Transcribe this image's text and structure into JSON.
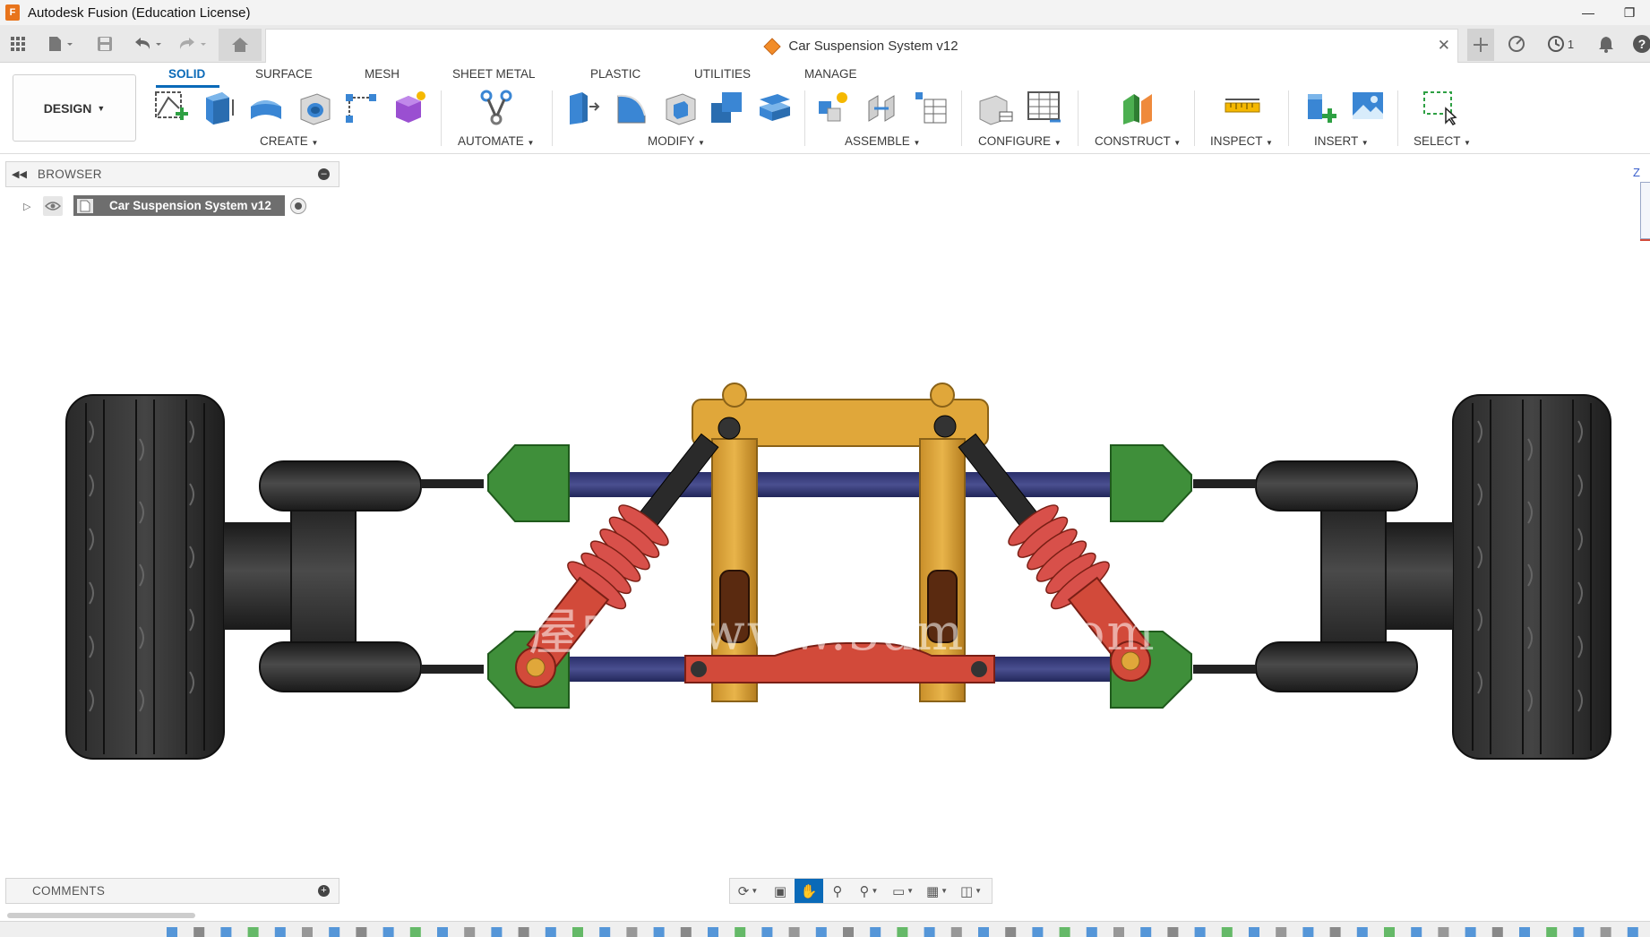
{
  "app": {
    "title": "Autodesk Fusion (Education License)",
    "icon_letter": "F",
    "brand_color": "#e8741c",
    "accent_color": "#0a6ab8"
  },
  "window_controls": [
    "minimize-icon",
    "restore-icon"
  ],
  "tabbar": {
    "document_tab_label": "Car Suspension System v12",
    "left_icons": [
      "grid-icon",
      "file-icon",
      "save-icon",
      "undo-icon",
      "redo-icon",
      "home-icon"
    ],
    "right_icons": [
      "plus-icon",
      "online-status-icon",
      "job-status-icon",
      "notifications-icon",
      "help-icon"
    ],
    "job_count": "1"
  },
  "ribbon": {
    "workspace_button": "DESIGN",
    "tabs": [
      "SOLID",
      "SURFACE",
      "MESH",
      "SHEET METAL",
      "PLASTIC",
      "UTILITIES",
      "MANAGE"
    ],
    "active_tab": "SOLID",
    "groups": [
      {
        "label": "CREATE",
        "tools": [
          "create-sketch-icon",
          "extrude-icon",
          "revolve-icon",
          "hole-icon",
          "pattern-icon",
          "form-icon"
        ]
      },
      {
        "label": "AUTOMATE",
        "tools": [
          "automate-icon"
        ]
      },
      {
        "label": "MODIFY",
        "tools": [
          "press-pull-icon",
          "fillet-icon",
          "shell-icon",
          "combine-icon",
          "offset-face-icon"
        ]
      },
      {
        "label": "ASSEMBLE",
        "tools": [
          "new-component-icon",
          "joint-icon",
          "bom-icon"
        ]
      },
      {
        "label": "CONFIGURE",
        "tools": [
          "configure-icon",
          "config-table-icon"
        ]
      },
      {
        "label": "CONSTRUCT",
        "tools": [
          "construct-plane-icon"
        ]
      },
      {
        "label": "INSPECT",
        "tools": [
          "measure-icon"
        ]
      },
      {
        "label": "INSERT",
        "tools": [
          "insert-icon",
          "insert-image-icon"
        ]
      },
      {
        "label": "SELECT",
        "tools": [
          "window-select-icon"
        ]
      }
    ]
  },
  "browser": {
    "header": "BROWSER",
    "root_node": "Car Suspension System v12"
  },
  "viewport": {
    "watermark": "屋内闪 www.3dmox.com",
    "viewcube_axis": "Z"
  },
  "comments": {
    "header": "COMMENTS"
  },
  "navbar": {
    "tools": [
      "orbit-icon",
      "look-at-icon",
      "pan-icon",
      "zoom-icon",
      "zoom-window-icon",
      "display-settings-icon",
      "grid-settings-icon",
      "viewports-icon"
    ],
    "active_tool": "pan-icon"
  }
}
